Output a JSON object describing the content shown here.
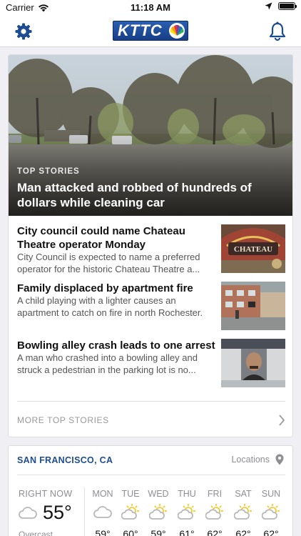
{
  "status_bar": {
    "carrier": "Carrier",
    "time": "11:18 AM"
  },
  "nav": {
    "logo_text": "KTTC"
  },
  "hero": {
    "kicker": "TOP STORIES",
    "title": "Man attacked and robbed of hundreds of dollars while cleaning car"
  },
  "stories": [
    {
      "title": "City council could name Chateau Theatre operator Monday",
      "summary": "City Council is expected to name a preferred operator for the historic Chateau Theatre a...",
      "thumb_text": "CHATEAU"
    },
    {
      "title": "Family displaced by apartment fire",
      "summary": "A child playing with a lighter causes an apartment to catch on fire in north Rochester."
    },
    {
      "title": "Bowling alley crash leads to one arrest",
      "summary": "A man who crashed into a bowling alley and struck a pedestrian in the parking lot is no..."
    }
  ],
  "more_top_stories": "MORE TOP STORIES",
  "weather": {
    "city": "SAN FRANCISCO, CA",
    "locations_label": "Locations",
    "now_label": "RIGHT NOW",
    "now_temp": "55°",
    "now_condition": "Overcast",
    "now_icon": "cloud-icon",
    "days": [
      {
        "label": "MON",
        "temp": "59°",
        "icon": "cloud-icon"
      },
      {
        "label": "TUE",
        "temp": "60°",
        "icon": "partly-sunny-icon"
      },
      {
        "label": "WED",
        "temp": "59°",
        "icon": "partly-sunny-icon"
      },
      {
        "label": "THU",
        "temp": "61°",
        "icon": "partly-sunny-icon"
      },
      {
        "label": "FRI",
        "temp": "62°",
        "icon": "partly-sunny-icon"
      },
      {
        "label": "SAT",
        "temp": "62°",
        "icon": "partly-sunny-icon"
      },
      {
        "label": "SUN",
        "temp": "62°",
        "icon": "partly-sunny-icon"
      }
    ]
  },
  "colors": {
    "accent": "#1e4c91",
    "sun": "#f5c518",
    "icon_gray": "#b8b8bc"
  }
}
